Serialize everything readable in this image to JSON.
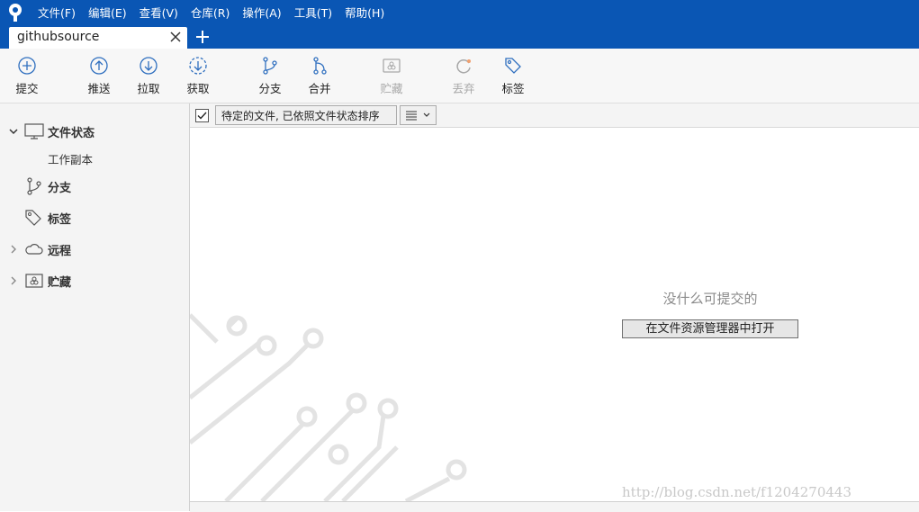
{
  "menu": {
    "items": [
      "文件(F)",
      "编辑(E)",
      "查看(V)",
      "仓库(R)",
      "操作(A)",
      "工具(T)",
      "帮助(H)"
    ]
  },
  "tab": {
    "label": "githubsource"
  },
  "toolbar": {
    "commit": "提交",
    "push": "推送",
    "pull": "拉取",
    "fetch": "获取",
    "branch": "分支",
    "merge": "合并",
    "stash": "贮藏",
    "discard": "丢弃",
    "tag": "标签"
  },
  "sidebar": {
    "file_status": "文件状态",
    "working_copy": "工作副本",
    "branches": "分支",
    "tags": "标签",
    "remotes": "远程",
    "stashes": "贮藏"
  },
  "filterbar": {
    "selected_option": "待定的文件, 已依照文件状态排序"
  },
  "main": {
    "empty_message": "没什么可提交的",
    "open_explorer_button": "在文件资源管理器中打开",
    "watermark": "http://blog.csdn.net/f1204270443"
  },
  "colors": {
    "brand_blue": "#0a56b4",
    "icon_blue": "#2f6fbf",
    "disabled_gray": "#a8a8a8"
  }
}
